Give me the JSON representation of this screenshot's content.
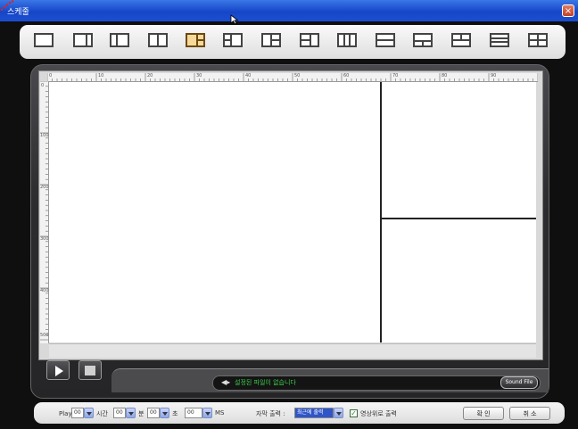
{
  "window": {
    "title": "스케줄",
    "close_label": "×"
  },
  "layout_options": [
    {
      "name": "layout-1",
      "selected": false
    },
    {
      "name": "layout-2",
      "selected": false
    },
    {
      "name": "layout-3",
      "selected": false
    },
    {
      "name": "layout-4",
      "selected": false
    },
    {
      "name": "layout-5",
      "selected": true
    },
    {
      "name": "layout-6",
      "selected": false
    },
    {
      "name": "layout-7",
      "selected": false
    },
    {
      "name": "layout-8",
      "selected": false
    },
    {
      "name": "layout-9",
      "selected": false
    },
    {
      "name": "layout-10",
      "selected": false
    },
    {
      "name": "layout-11",
      "selected": false
    },
    {
      "name": "layout-12",
      "selected": false
    },
    {
      "name": "layout-13",
      "selected": false
    },
    {
      "name": "layout-14",
      "selected": false
    }
  ],
  "ruler": {
    "top_labels": [
      "0",
      "10",
      "20",
      "30",
      "40",
      "50",
      "60",
      "70",
      "80",
      "90"
    ],
    "left_labels": [
      "0",
      "100",
      "200",
      "300",
      "400",
      "500"
    ]
  },
  "player": {
    "status_text": "설정된 파일이 없습니다",
    "sound_file_label": "Sound File"
  },
  "bottom": {
    "play_time_label": "Play 시간 :",
    "hour_value": "00",
    "hour_label": "시간",
    "minute_value": "00",
    "minute_label": "분",
    "second_value": "00",
    "second_label": "초",
    "ms_value": "00",
    "ms_label": "MS",
    "subtitle_label": "자막 출력 :",
    "subtitle_value": "최근에 출력",
    "video_checkbox_label": "영상위로 출력",
    "video_checkbox_checked": true,
    "ok_label": "확 인",
    "cancel_label": "취 소"
  },
  "colors": {
    "accent": "#f7d99a",
    "status_text": "#3ccd4a",
    "titlebar": "#1546c8"
  }
}
